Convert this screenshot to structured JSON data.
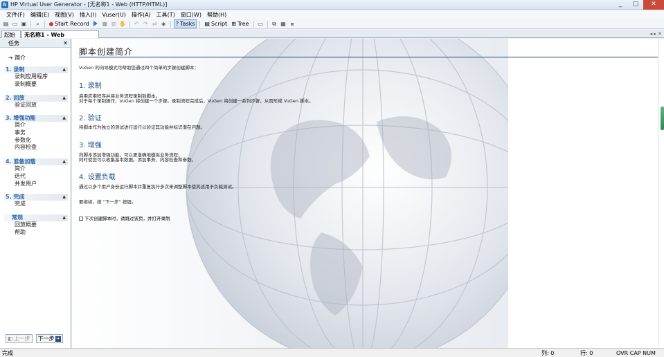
{
  "window": {
    "title": "HP Virtual User Generator - [无名称1 - Web (HTTP/HTML)]",
    "controls": [
      "_",
      "▢",
      "✕"
    ]
  },
  "menu": [
    "文件(F)",
    "编辑(E)",
    "视图(V)",
    "插入(I)",
    "Vuser(U)",
    "操作(A)",
    "工具(T)",
    "窗口(W)",
    "帮助(H)"
  ],
  "toolbar": {
    "start_record": "Start Record",
    "tasks": "Tasks",
    "script": "Script",
    "tree": "Tree"
  },
  "tabs": {
    "start_page": "起始页",
    "document": "无名称1 - Web (HTTP/HTML)",
    "arrows": "◂ ▸ ✕"
  },
  "task_pane": {
    "header": "任务",
    "close": "✕",
    "intro": "简介",
    "steps": [
      {
        "title": "1. 录制",
        "items": [
          "录制应用程序",
          "录制概要"
        ]
      },
      {
        "title": "2. 回放",
        "items": [
          "验证回放"
        ]
      },
      {
        "title": "3. 增强功能",
        "items": [
          "简介",
          "事务",
          "参数化",
          "内容检查"
        ]
      },
      {
        "title": "4. 准备加载",
        "items": [
          "简介",
          "迭代",
          "并发用户"
        ]
      },
      {
        "title": "5. 完成",
        "items": [
          "完成"
        ]
      },
      {
        "title": "常规",
        "items": [
          "回放概要",
          "帮助"
        ]
      }
    ],
    "prev_button": "上一步",
    "next_button": "下一步"
  },
  "main": {
    "page_title": "脚本创建简介",
    "intro": "VuGen 的向导模式可帮助您通过四个简单的步骤创建脚本：",
    "sections": [
      {
        "title": "1. 录制",
        "lines": [
          "启用应用程序并将业务流程录制到脚本。",
          "对于每个录制操作，VuGen 将创建一个步骤。录制流程完成后，VuGen 将创建一系列步骤，从而形成 VuGen 脚本。"
        ]
      },
      {
        "title": "2. 验证",
        "lines": [
          "将脚本作为独立的测试进行运行以验证其功能并标识潜在问题。"
        ]
      },
      {
        "title": "3. 增强",
        "lines": [
          "向脚本添加增强功能，可以更准确地模拟业务流程，",
          "同时使您可以收集基本数据。添加事务、内容检查和参数。"
        ]
      },
      {
        "title": "4. 设置负载",
        "lines": [
          "通过以多个用户身份运行脚本并重复执行多次来调整脚本使其适用于负载测试。"
        ]
      }
    ],
    "continue_text": "要继续，按 “下一步” 按钮。",
    "checkbox_label": "下次创建脚本时，请跳过该页，并打开录制"
  },
  "status": {
    "left": "完成",
    "col": "列: 0",
    "row": "行: 0",
    "indicators": "OVR CAP NUM SCRL"
  }
}
